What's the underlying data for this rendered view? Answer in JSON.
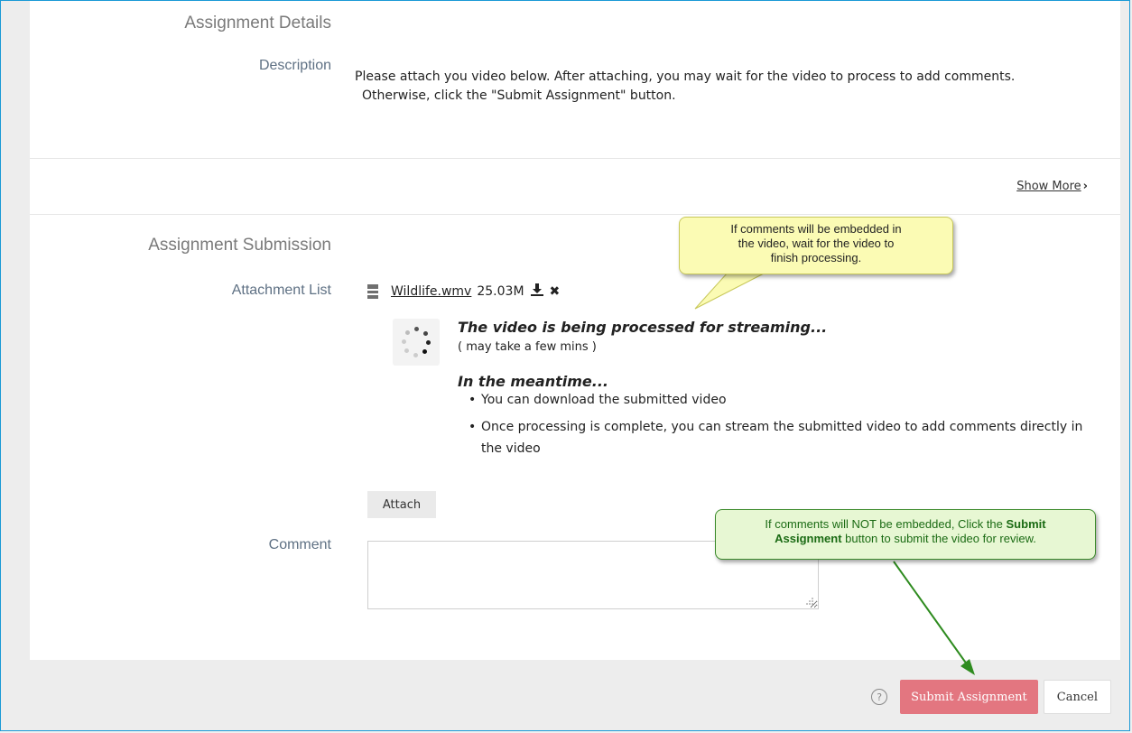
{
  "details": {
    "title": "Assignment Details",
    "description_label": "Description",
    "description_line1": "Please attach you video below.  After attaching, you may wait for the video to process to add comments.",
    "description_line2": "Otherwise, click the \"Submit Assignment\" button.",
    "show_more": "Show More"
  },
  "submission": {
    "title": "Assignment Submission",
    "attachment_label": "Attachment List",
    "file_name": "Wildlife.wmv",
    "file_size": "25.03M",
    "processing_title": "The video is being processed for streaming...",
    "processing_sub": "( may take a few mins )",
    "meantime_title": "In the meantime...",
    "bullets": [
      "You can download the submitted video",
      "Once processing is complete, you can stream the submitted video to add comments directly in the video"
    ],
    "attach_button": "Attach",
    "comment_label": "Comment",
    "comment_value": ""
  },
  "callouts": {
    "yellow": {
      "line1": "If comments will be embedded in",
      "line2": "the video, wait for the video to",
      "line3": "finish processing."
    },
    "green": {
      "pre": "If comments will NOT be embedded, Click the ",
      "bold1": "Submit",
      "bold2": "Assignment",
      "post": " button to submit the video for review."
    }
  },
  "footer": {
    "help_glyph": "?",
    "submit": "Submit Assignment",
    "cancel": "Cancel"
  },
  "colors": {
    "submit_bg": "#e37680",
    "frame_border": "#1a9ad6",
    "arrow_green": "#2e8b1f"
  },
  "icons": [
    "film-icon",
    "download-icon",
    "remove-icon",
    "spinner-icon",
    "chevron-right-icon",
    "help-icon"
  ]
}
